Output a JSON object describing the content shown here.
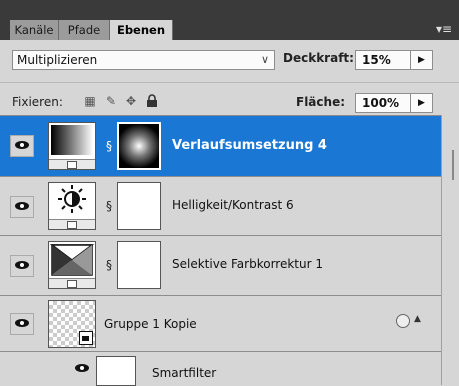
{
  "tabs": [
    {
      "label": "Kanäle",
      "active": false
    },
    {
      "label": "Pfade",
      "active": false
    },
    {
      "label": "Ebenen",
      "active": true
    }
  ],
  "blend": {
    "mode": "Multiplizieren",
    "opacity_label": "Deckkraft:",
    "opacity_value": "15%"
  },
  "lock": {
    "label": "Fixieren:",
    "fill_label": "Fläche:",
    "fill_value": "100%"
  },
  "layers": [
    {
      "name": "Verlaufsumsetzung 4",
      "selected": true
    },
    {
      "name": "Helligkeit/Kontrast 6",
      "selected": false
    },
    {
      "name": "Selektive Farbkorrektur 1",
      "selected": false
    },
    {
      "name": "Gruppe 1 Kopie",
      "selected": false
    },
    {
      "name": "Smartfilter",
      "selected": false
    }
  ],
  "colors": {
    "selection": "#1a78d4",
    "panel": "#d6d6d6",
    "tabbar": "#3a3a3a"
  }
}
